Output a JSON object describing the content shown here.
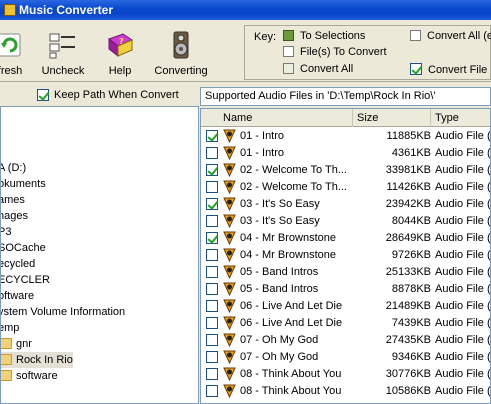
{
  "window": {
    "title": "Music Converter"
  },
  "toolbar": {
    "refresh_label": "fresh",
    "uncheck_label": "Uncheck",
    "help_label": "Help",
    "converting_label": "Converting"
  },
  "key": {
    "title": "Key:",
    "to_selections": "To Selections",
    "files_to_convert": "File(s) To Convert",
    "convert_all": "Convert All",
    "convert_all_e": "Convert All (e",
    "convert_file": "Convert File"
  },
  "keep_path": {
    "label": "Keep Path When Convert",
    "checked": true
  },
  "path_label": "Supported Audio Files in 'D:\\Temp\\Rock In Rio\\'",
  "tree": [
    "A (D:)",
    "okuments",
    "ames",
    "nages",
    "P3",
    "SOCache",
    "ecycled",
    "ECYCLER",
    "oftware",
    "ystem Volume Information",
    "emp",
    "gnr",
    "Rock In Rio",
    "software"
  ],
  "columns": {
    "name": "Name",
    "size": "Size",
    "type": "Type"
  },
  "files": [
    {
      "name": "01 - Intro",
      "size": "11885KB",
      "type": "Audio File (F",
      "checked": true
    },
    {
      "name": "01 - Intro",
      "size": "4361KB",
      "type": "Audio File (M",
      "checked": false
    },
    {
      "name": "02 - Welcome To Th...",
      "size": "33981KB",
      "type": "Audio File (F",
      "checked": true
    },
    {
      "name": "02 - Welcome To Th...",
      "size": "11426KB",
      "type": "Audio File (M",
      "checked": false
    },
    {
      "name": "03 - It's So Easy",
      "size": "23942KB",
      "type": "Audio File (F",
      "checked": true
    },
    {
      "name": "03 - It's So Easy",
      "size": "8044KB",
      "type": "Audio File (M",
      "checked": false
    },
    {
      "name": "04 - Mr Brownstone",
      "size": "28649KB",
      "type": "Audio File (F",
      "checked": true
    },
    {
      "name": "04 - Mr Brownstone",
      "size": "9726KB",
      "type": "Audio File (M",
      "checked": false
    },
    {
      "name": "05 - Band Intros",
      "size": "25133KB",
      "type": "Audio File (F",
      "checked": false
    },
    {
      "name": "05 - Band Intros",
      "size": "8878KB",
      "type": "Audio File (M",
      "checked": false
    },
    {
      "name": "06 - Live And Let Die",
      "size": "21489KB",
      "type": "Audio File (F",
      "checked": false
    },
    {
      "name": "06 - Live And Let Die",
      "size": "7439KB",
      "type": "Audio File (M",
      "checked": false
    },
    {
      "name": "07 - Oh My God",
      "size": "27435KB",
      "type": "Audio File (F",
      "checked": false
    },
    {
      "name": "07 - Oh My God",
      "size": "9346KB",
      "type": "Audio File (M",
      "checked": false
    },
    {
      "name": "08 - Think About You",
      "size": "30776KB",
      "type": "Audio File (F",
      "checked": false
    },
    {
      "name": "08 - Think About You",
      "size": "10586KB",
      "type": "Audio File (M",
      "checked": false
    }
  ]
}
